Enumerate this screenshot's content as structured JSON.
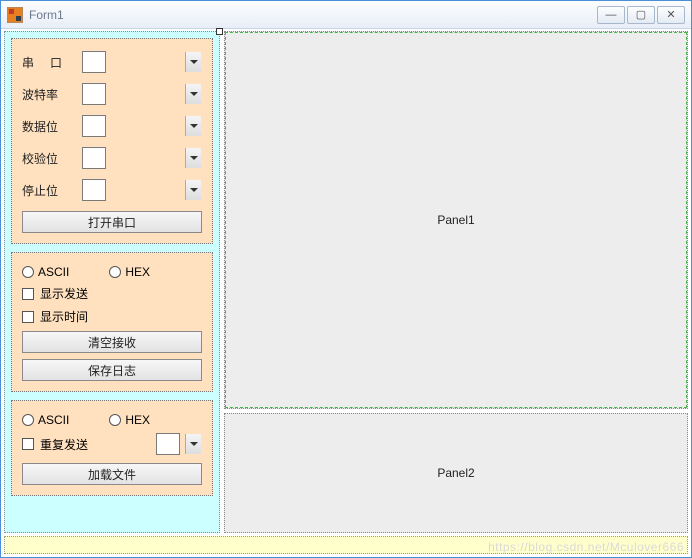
{
  "window": {
    "title": "Form1"
  },
  "serial": {
    "port_label": "串　口",
    "baud_label": "波特率",
    "data_label": "数据位",
    "parity_label": "校验位",
    "stop_label": "停止位",
    "open_btn": "打开串口"
  },
  "recv": {
    "ascii": "ASCII",
    "hex": "HEX",
    "show_send": "显示发送",
    "show_time": "显示时间",
    "clear_btn": "清空接收",
    "save_btn": "保存日志"
  },
  "send": {
    "ascii": "ASCII",
    "hex": "HEX",
    "repeat": "重复发送",
    "load_btn": "加载文件"
  },
  "panels": {
    "p1": "Panel1",
    "p2": "Panel2"
  },
  "watermark": "https://blog.csdn.net/Mculover666"
}
